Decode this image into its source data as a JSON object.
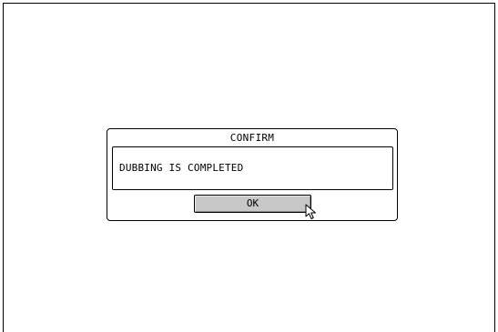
{
  "dialog": {
    "title": "CONFIRM",
    "message": "DUBBING IS COMPLETED",
    "ok_label": "OK"
  },
  "cursor": {
    "icon": "mouse-pointer-icon"
  }
}
